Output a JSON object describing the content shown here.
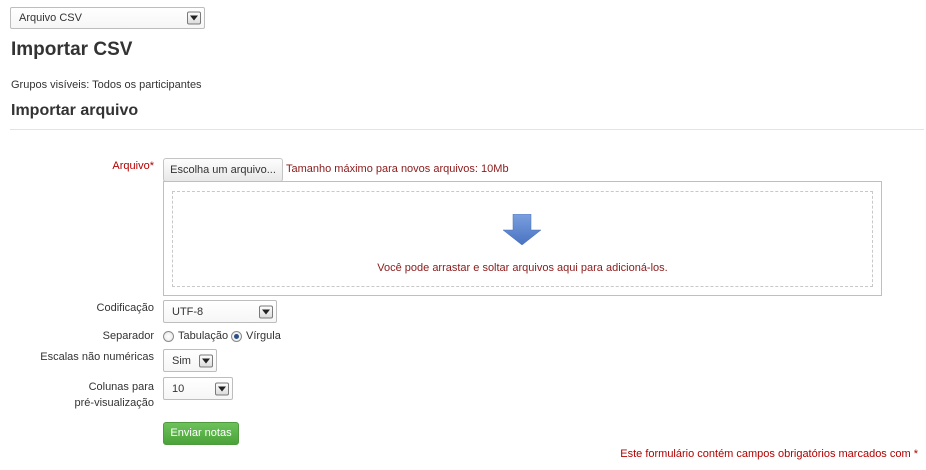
{
  "top_select": {
    "value": "Arquivo CSV"
  },
  "page_title": "Importar CSV",
  "groups_text": "Grupos visíveis: Todos os participantes",
  "section_title": "Importar arquivo",
  "file_field": {
    "label": "Arquivo",
    "required_marker": "*",
    "choose_button": "Escolha um arquivo...",
    "max_size": "Tamanho máximo para novos arquivos: 10Mb",
    "drop_message": "Você pode arrastar e soltar arquivos aqui para adicioná-los."
  },
  "encoding": {
    "label": "Codificação",
    "value": "UTF-8"
  },
  "separator": {
    "label": "Separador",
    "options": [
      {
        "label": "Tabulação",
        "checked": false
      },
      {
        "label": "Vírgula",
        "checked": true
      }
    ]
  },
  "non_numeric_scales": {
    "label": "Escalas não numéricas",
    "value": "Sim"
  },
  "preview_columns": {
    "label_line1": "Colunas para",
    "label_line2": "pré-visualização",
    "value": "10"
  },
  "submit_button": "Enviar notas",
  "required_note": "Este formulário contém campos obrigatórios marcados com",
  "required_note_marker": "*",
  "colors": {
    "required": "#b20000",
    "submit": "#5cb34a",
    "drop_arrow": "#5b84cf"
  },
  "icons": {
    "drop": "down-arrow-icon",
    "select": "chevron-down-icon"
  }
}
